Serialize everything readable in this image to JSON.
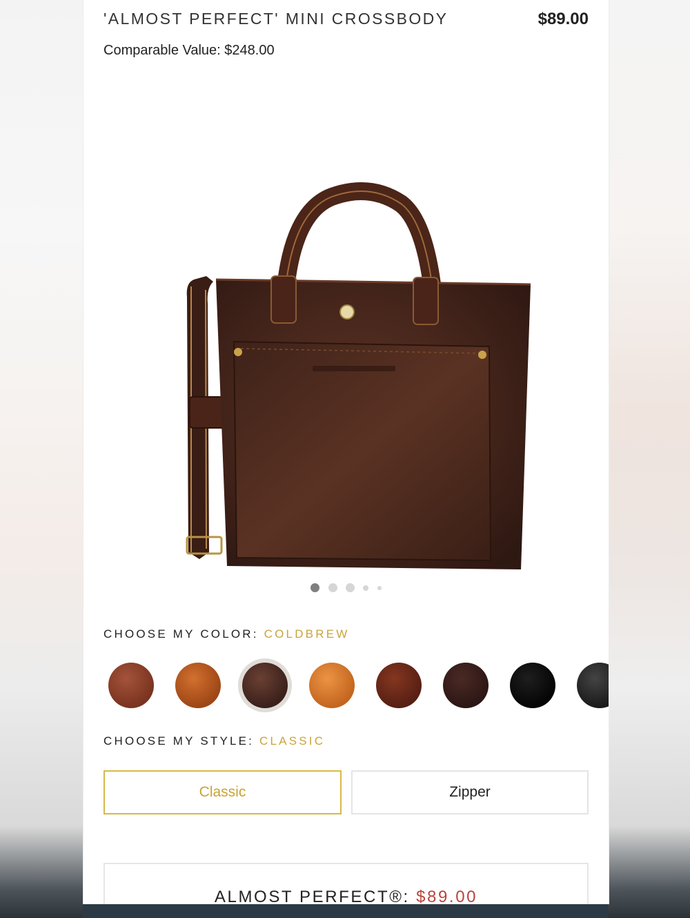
{
  "product": {
    "title": "'ALMOST PERFECT' MINI CROSSBODY",
    "price": "$89.00",
    "comparable_value": "Comparable Value: $248.00"
  },
  "gallery": {
    "image_alt": "dark brown leather mini crossbody tote bag",
    "dot_count": 5,
    "active_index": 0
  },
  "color": {
    "label": "CHOOSE MY COLOR:",
    "selected": "COLDBREW",
    "swatches": [
      {
        "name": "swatch-1",
        "color": "#8a3f26"
      },
      {
        "name": "swatch-2",
        "color": "#b8571f"
      },
      {
        "name": "swatch-coldbrew",
        "color": "#4a2a22",
        "selected": true
      },
      {
        "name": "swatch-4",
        "color": "#d67a2f"
      },
      {
        "name": "swatch-5",
        "color": "#6b2a1c"
      },
      {
        "name": "swatch-6",
        "color": "#3a1f1c"
      },
      {
        "name": "swatch-7",
        "color": "#0e0e0e"
      },
      {
        "name": "swatch-8",
        "color": "#2a2a2a"
      }
    ]
  },
  "style": {
    "label": "CHOOSE MY STYLE:",
    "selected": "CLASSIC",
    "options": [
      "Classic",
      "Zipper"
    ]
  },
  "cta": {
    "label": "ALMOST PERFECT®:",
    "price": "$89.00"
  },
  "colors": {
    "accent_gold": "#c8a43a",
    "price_red": "#b9443c",
    "footer": "#2b3a44"
  }
}
